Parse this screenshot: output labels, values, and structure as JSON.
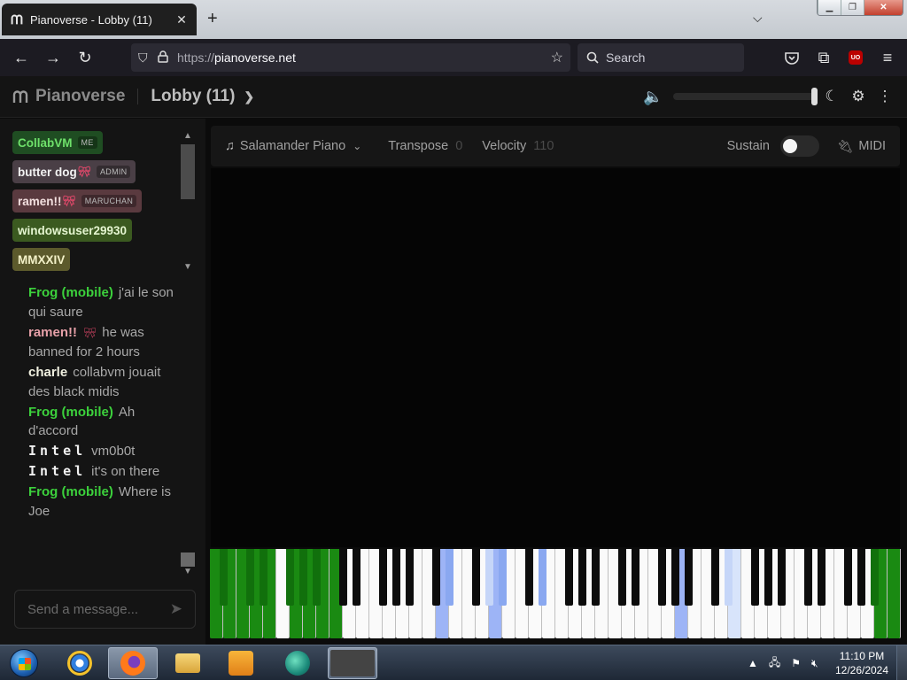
{
  "browser": {
    "tab_title": "Pianoverse - Lobby (11)",
    "url_protocol": "https://",
    "url_domain": "pianoverse.net",
    "search_placeholder": "Search",
    "ublock_label": "UO"
  },
  "app": {
    "brand": "Pianoverse",
    "room": "Lobby (11)",
    "volume_fraction": 1.0
  },
  "users": [
    {
      "name": "CollabVM",
      "tag": "ME",
      "bow": false
    },
    {
      "name": "butter dog",
      "tag": "ADMIN",
      "bow": true
    },
    {
      "name": "ramen!!",
      "tag": "MARUCHAN",
      "bow": true
    },
    {
      "name": "windowsuser29930",
      "tag": "",
      "bow": false
    },
    {
      "name": "MMXXIV",
      "tag": "",
      "bow": false
    }
  ],
  "chat": [
    {
      "nick": "Frog (mobile)",
      "text": "j'ai le son qui saure"
    },
    {
      "nick": "ramen!!",
      "text": "he was banned for 2 hours"
    },
    {
      "nick": "charle",
      "text": "collabvm jouait des black midis"
    },
    {
      "nick": "Frog (mobile)",
      "text": "Ah d'accord"
    },
    {
      "nick": "Intel",
      "text": "vm0b0t"
    },
    {
      "nick": "Intel",
      "text": "it's on there"
    },
    {
      "nick": "Frog (mobile)",
      "text": "Where is Joe"
    }
  ],
  "chat_input_placeholder": "Send a message...",
  "toolbar": {
    "instrument": "Salamander Piano",
    "transpose_label": "Transpose",
    "transpose_value": "0",
    "velocity_label": "Velocity",
    "velocity_value": "110",
    "sustain_label": "Sustain",
    "sustain_on": false,
    "midi_label": "MIDI"
  },
  "colors": {
    "pressed_green": "#1a8a12",
    "pressed_blue": "#9db4f6",
    "pressed_lightblue": "#d8e4fb"
  },
  "taskbar": {
    "time": "11:10 PM",
    "date": "12/26/2024"
  }
}
